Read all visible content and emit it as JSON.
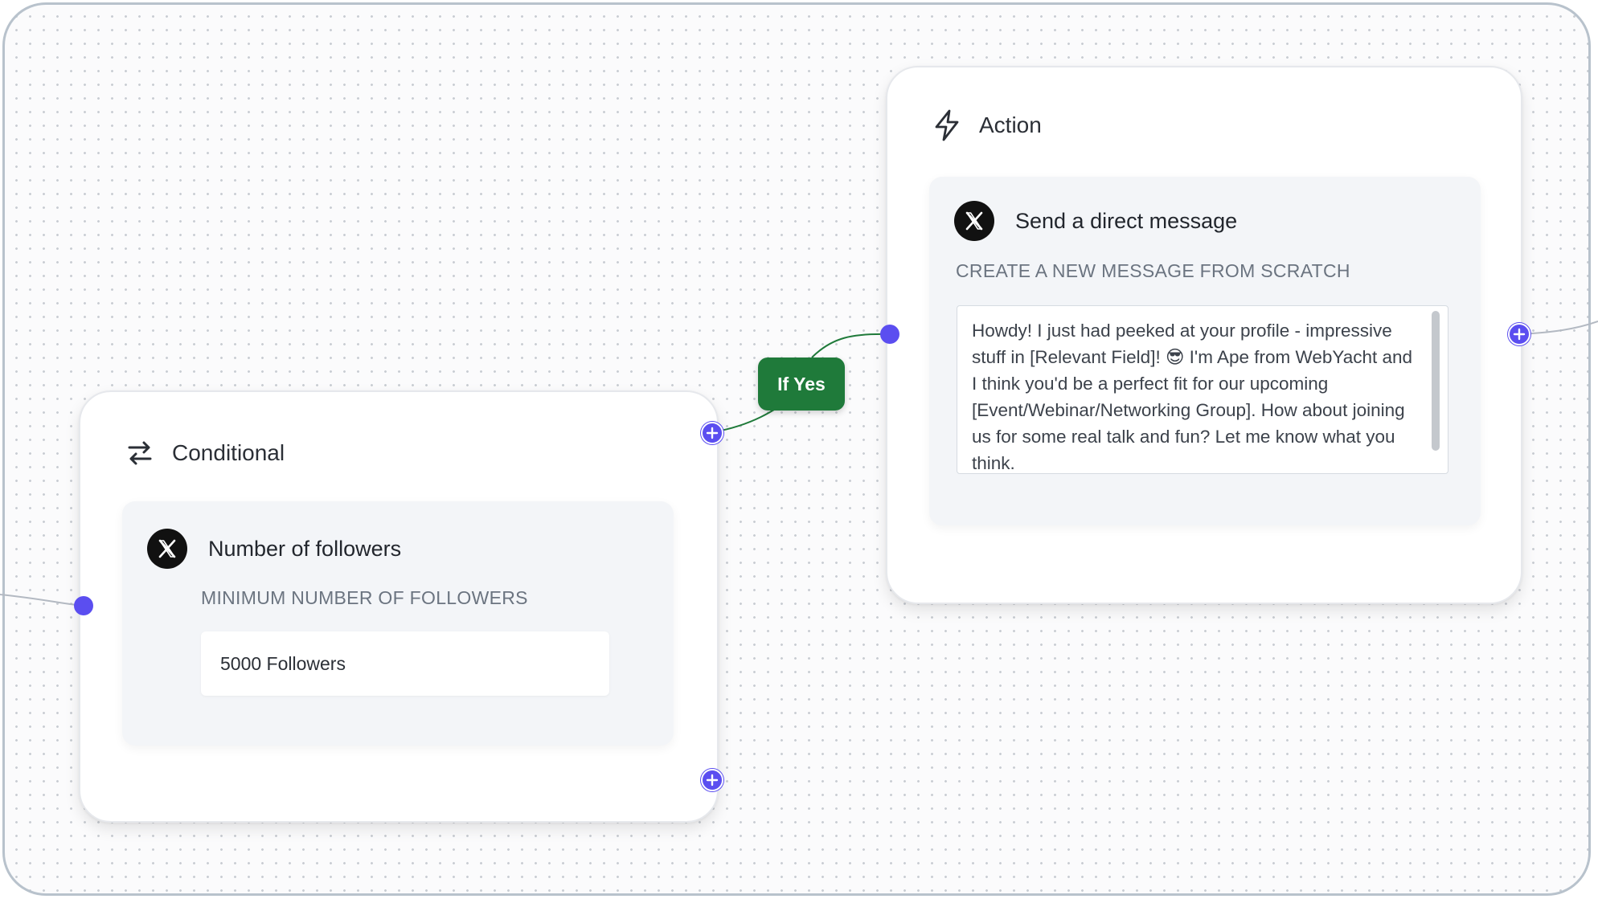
{
  "canvas": {
    "conditional_node": {
      "title": "Conditional",
      "icon": "swap-arrows-icon",
      "trigger": {
        "icon": "x-logo-icon",
        "label": "Number of followers",
        "field_label": "MINIMUM NUMBER OF FOLLOWERS",
        "field_value": "5000 Followers"
      }
    },
    "edge_label": "If Yes",
    "action_node": {
      "title": "Action",
      "icon": "lightning-bolt-icon",
      "step": {
        "icon": "x-logo-icon",
        "label": "Send a direct message",
        "field_label": "CREATE A NEW MESSAGE FROM SCRATCH",
        "message_part1": "Howdy! I just had peeked at your profile - impressive stuff in [Relevant Field]! ",
        "message_emoji": "😎",
        "message_part2": " I'm Ape from WebYacht and I think you'd be a perfect fit for our upcoming [Event/Webinar/Networking Group]. How about joining us for some real talk and fun? Let me know what you think."
      }
    },
    "colors": {
      "port": "#5b4ef0",
      "edge_label_bg": "#1f7a3a",
      "edge_line": "#1f7a3a"
    }
  }
}
